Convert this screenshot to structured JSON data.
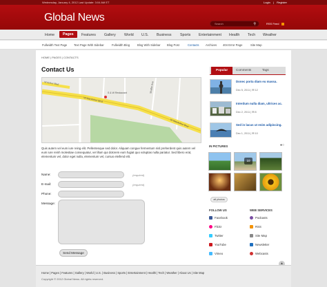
{
  "topbar": {
    "date": "Wednesday, January 4, 2012  Last Update: 3:04 AM ET",
    "login": "Login",
    "sep": "|",
    "register": "Register"
  },
  "header": {
    "logo": "Global News",
    "search_placeholder": "Search",
    "rss_label": "RSS Feed"
  },
  "nav": {
    "items": [
      "Home",
      "Pages",
      "Features",
      "Gallery",
      "World",
      "U.S.",
      "Business",
      "Sports",
      "Entertainment",
      "Health",
      "Tech",
      "Weather"
    ]
  },
  "subnav": {
    "items": [
      "Fullwidth Text Page",
      "Text Page With Sidebar",
      "Fullwidth Blog",
      "Blog With Sidebar",
      "Blog Post",
      "Contacts",
      "Archives",
      "404 Error Page",
      "Site Map"
    ]
  },
  "breadcrumb": {
    "text": "HOME  |  PAGES  |  CONTACTS"
  },
  "main": {
    "title": "Contact Us",
    "map_labels": [
      "W Arthur Blvd",
      "Shaffer Ave",
      "W MacArthur Blvd",
      "W MacArthur Blvd",
      "S & W Restaurant"
    ],
    "intro": "Quis autem vel eum iure reing elit. Pellentesque sed dolor. Aliquam congue fermentum nisl preherdent quis autem vel eum iure reinh molestiae consequatur, vel illum qui dolorem eum fugiat quo voluptas nulla pariatur. Sed libero erat, elementum vel, dolor eget nulla, elementum vel, cursus eleifend elit."
  },
  "form": {
    "name_label": "Name:",
    "email_label": "E-mail:",
    "phone_label": "Phone:",
    "message_label": "Message:",
    "required": "(required)",
    "send": "Send Message"
  },
  "sidebar": {
    "tabs": [
      "Popular",
      "Comments",
      "Tags"
    ],
    "popular": [
      {
        "title": "Donec porta diam eu massa.",
        "date": "Dec 5, 2011  |  ✉ 12"
      },
      {
        "title": "Interdum nulla diam, ultrices ac.",
        "date": "Dec 2, 2011  |  ✉ 8"
      },
      {
        "title": "Sed in lacus ut enim adipiscing.",
        "date": "Dec 1, 2011  |  ✉ 10"
      }
    ],
    "in_pictures": "IN PICTURES",
    "gallery_badge": "10",
    "all_photos": "all photos",
    "follow_us": "FOLLOW US",
    "web_services": "WEB SERVICES",
    "follow": [
      "Facebook",
      "Flickr",
      "Twitter",
      "YouTube",
      "Vimeo"
    ],
    "services": [
      "Podcasts",
      "RSS",
      "Site Map",
      "Newsletter",
      "Webcasts"
    ],
    "follow_colors": [
      "#3b5998",
      "#ff0084",
      "#33ccff",
      "#cc181e",
      "#44bbff"
    ],
    "service_colors": [
      "#7a4ea3",
      "#f39200",
      "#888888",
      "#1e6fbf",
      "#d03030"
    ]
  },
  "footer": {
    "links": "Home  |  Pages  |  Features  |  Gallery  |  World  |  U.S.  |  Business  |  Sports  |  Entertainment  |  Health  |  Tech  |  Weather  |  About Us  |  Site Map",
    "copyright": "Copyright © 2012 Global News. All rights reserved."
  }
}
